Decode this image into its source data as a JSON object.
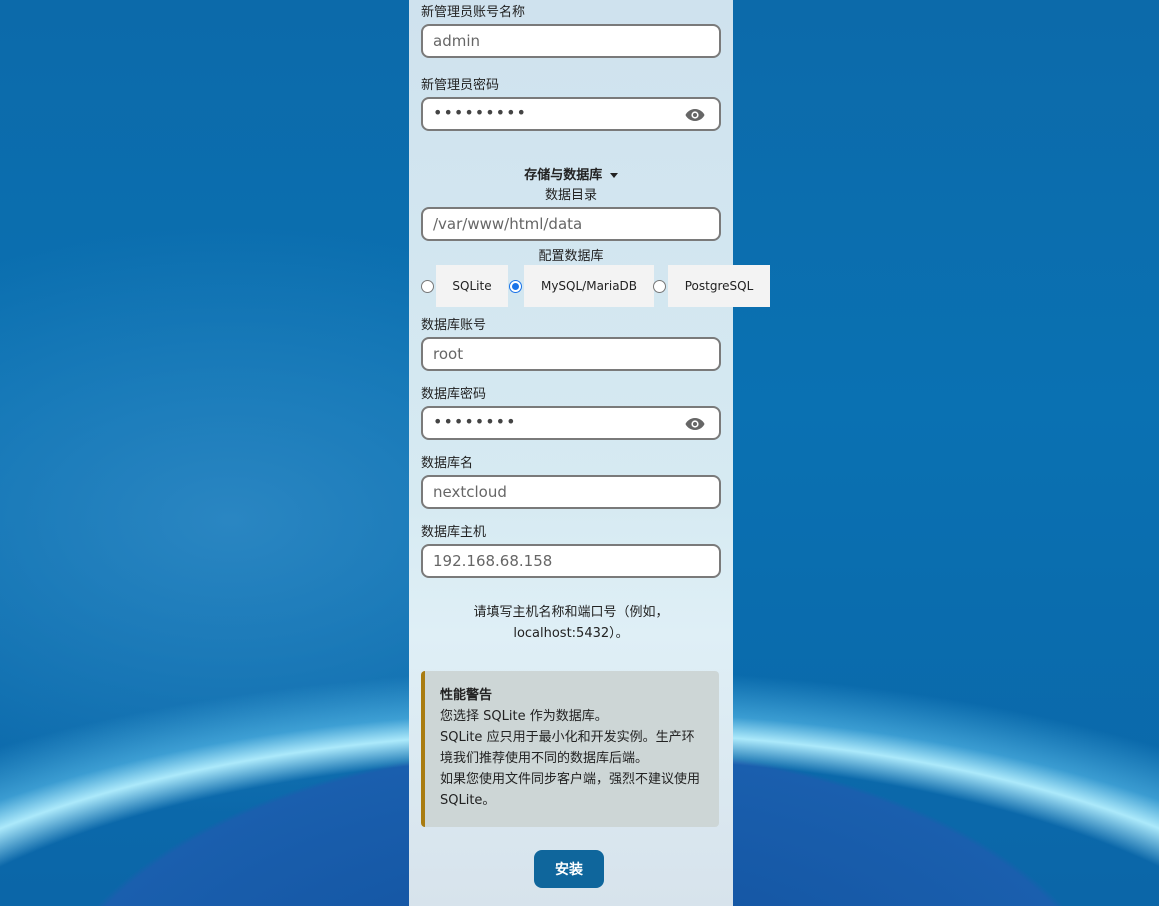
{
  "admin": {
    "username_label": "新管理员账号名称",
    "username_value": "admin",
    "password_label": "新管理员密码",
    "password_value": "•••••••••"
  },
  "storage": {
    "toggle_label": "存储与数据库",
    "data_dir_label": "数据目录",
    "data_dir_value": "/var/www/html/data",
    "db_config_label": "配置数据库",
    "db_options": [
      "SQLite",
      "MySQL/MariaDB",
      "PostgreSQL"
    ],
    "selected_db": "MySQL/MariaDB"
  },
  "database": {
    "user_label": "数据库账号",
    "user_value": "root",
    "password_label": "数据库密码",
    "password_value": "••••••••",
    "name_label": "数据库名",
    "name_value": "nextcloud",
    "host_label": "数据库主机",
    "host_value": "192.168.68.158",
    "host_hint_line1": "请填写主机名称和端口号（例如，",
    "host_hint_line2": "localhost:5432）。"
  },
  "warning": {
    "title": "性能警告",
    "line1": "您选择 SQLite 作为数据库。",
    "line2": "SQLite 应只用于最小化和开发实例。生产环",
    "line3": "境我们推荐使用不同的数据库后端。",
    "line4": "如果您使用文件同步客户端，强烈不建议使用",
    "line5": "SQLite。",
    "accent_color": "#a97c11"
  },
  "install_button": "安装",
  "colors": {
    "primary": "#0f669c",
    "radio_selected": "#1a73e8"
  }
}
